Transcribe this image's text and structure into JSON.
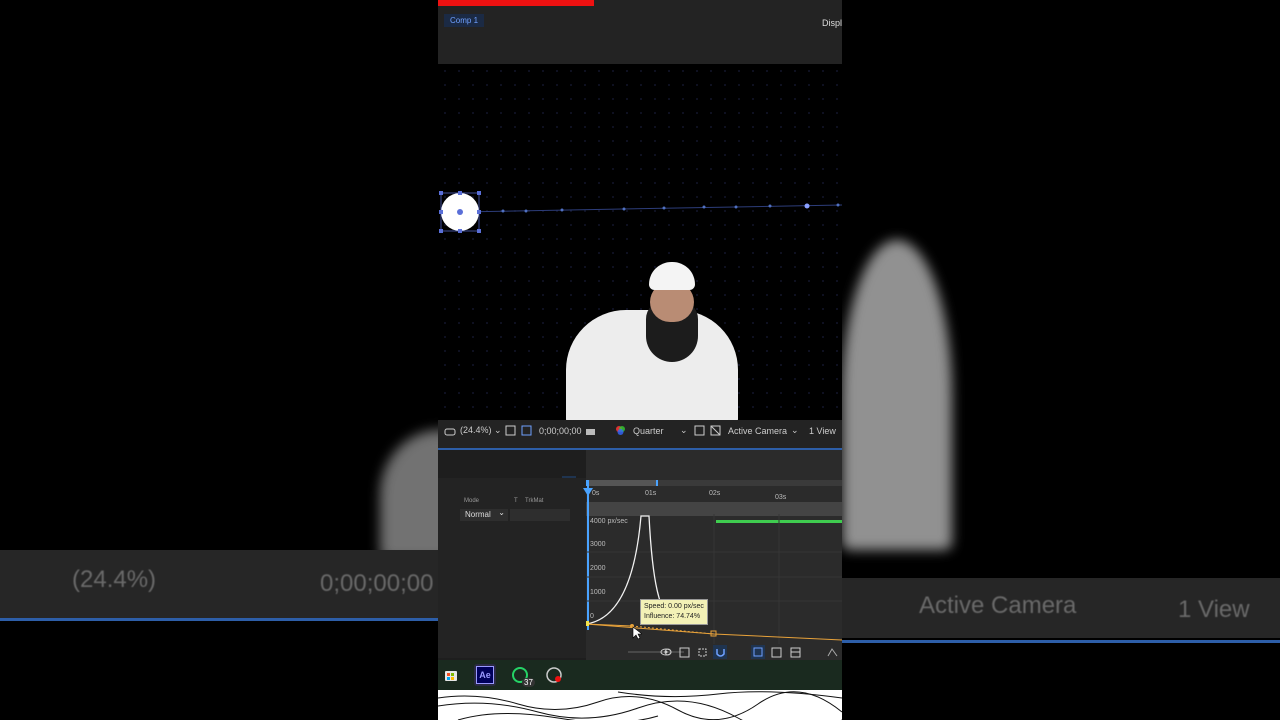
{
  "composition": {
    "tab_label": "Comp 1",
    "display_label": "Displ"
  },
  "viewer_bar": {
    "zoom": "(24.4%)",
    "timecode": "0;00;00;00",
    "resolution": "Quarter",
    "camera": "Active Camera",
    "views": "1 View"
  },
  "timeline": {
    "ruler_ticks": [
      "0s",
      "01s",
      "02s",
      "03s"
    ],
    "column_headers": {
      "mode": "Mode",
      "t": "T",
      "trkmat": "TrkMat"
    },
    "layer_mode": "Normal",
    "graph_y_labels": [
      "4000 px/sec",
      "3000",
      "2000",
      "1000",
      "0"
    ],
    "tooltip": {
      "speed": "Speed: 0.00 px/sec",
      "influence": "Influence: 74.74%"
    }
  },
  "taskbar": {
    "apps": [
      {
        "name": "store",
        "label": ""
      },
      {
        "name": "after-effects",
        "label": "Ae"
      },
      {
        "name": "whatsapp",
        "label": "",
        "badge": "37"
      },
      {
        "name": "recorder",
        "label": ""
      }
    ]
  },
  "background_zoom": {
    "zoom": "(24.4%)",
    "timecode": "0;00;00;00",
    "camera": "Active Camera",
    "views": "1 View"
  },
  "colors": {
    "accent_blue": "#2d5ea8",
    "redbar": "#e11111",
    "curve_white": "#f2f2f2",
    "handle_orange": "#e8a23a",
    "green_track": "#3fcc4f"
  }
}
